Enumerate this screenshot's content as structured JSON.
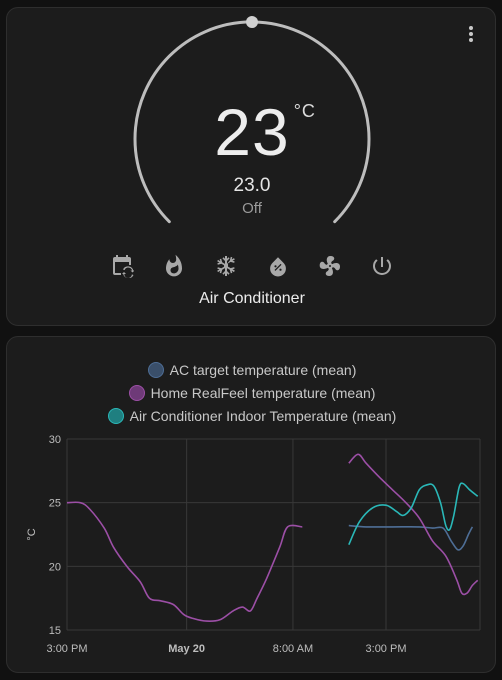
{
  "thermostat": {
    "target_temp": "23",
    "unit": "°C",
    "current_temp": "23.0",
    "hvac_state": "Off",
    "name": "Air Conditioner",
    "setpoint_fraction": 0.5,
    "modes": [
      {
        "icon": "calendar-sync-icon",
        "name": "auto"
      },
      {
        "icon": "fire-icon",
        "name": "heat"
      },
      {
        "icon": "snowflake-icon",
        "name": "cool"
      },
      {
        "icon": "water-percent-icon",
        "name": "dry"
      },
      {
        "icon": "fan-icon",
        "name": "fan_only"
      },
      {
        "icon": "power-icon",
        "name": "off"
      }
    ]
  },
  "history": {
    "legend": [
      {
        "label": "AC target temperature (mean)",
        "color": "#4e6e96"
      },
      {
        "label": "Home RealFeel temperature (mean)",
        "color": "#9c4fa6"
      },
      {
        "label": "Air Conditioner Indoor Temperature (mean)",
        "color": "#2ab8b8"
      }
    ]
  },
  "chart_data": {
    "type": "line",
    "ylabel": "°C",
    "ylim": [
      15,
      30
    ],
    "yticks": [
      15,
      20,
      25,
      30
    ],
    "xticks": [
      {
        "label": "3:00 PM",
        "t": 0,
        "bold": false
      },
      {
        "label": "May 20",
        "t": 9,
        "bold": true
      },
      {
        "label": "8:00 AM",
        "t": 17,
        "bold": false
      },
      {
        "label": "3:00 PM",
        "t": 24,
        "bold": false
      }
    ],
    "xlim": [
      0,
      31
    ],
    "grid": true,
    "series": [
      {
        "name": "AC target temperature (mean)",
        "color": "#4e6e96",
        "points": [
          [
            21.2,
            23.2
          ],
          [
            22.5,
            23.1
          ],
          [
            24.5,
            23.1
          ],
          [
            26.5,
            23.1
          ],
          [
            27.5,
            23.0
          ],
          [
            28.3,
            23.0
          ],
          [
            28.9,
            22.0
          ],
          [
            29.4,
            21.3
          ],
          [
            29.8,
            21.6
          ],
          [
            30.2,
            22.5
          ],
          [
            30.5,
            23.1
          ]
        ]
      },
      {
        "name": "Home RealFeel temperature (mean)",
        "color": "#9c4fa6",
        "points": [
          [
            0,
            25.0
          ],
          [
            1,
            25.0
          ],
          [
            1.7,
            24.5
          ],
          [
            2.8,
            23.0
          ],
          [
            3.5,
            21.5
          ],
          [
            4.5,
            20.0
          ],
          [
            5.5,
            18.8
          ],
          [
            6.2,
            17.5
          ],
          [
            7,
            17.3
          ],
          [
            8,
            17.0
          ],
          [
            8.8,
            16.2
          ],
          [
            9.5,
            15.9
          ],
          [
            10.5,
            15.7
          ],
          [
            11.5,
            15.8
          ],
          [
            12.5,
            16.5
          ],
          [
            13.2,
            16.8
          ],
          [
            13.8,
            16.5
          ],
          [
            14.3,
            17.5
          ],
          [
            15,
            19.0
          ],
          [
            16,
            21.5
          ],
          [
            16.6,
            23.1
          ],
          [
            17.7,
            23.1
          ],
          [
            21.2,
            28.1
          ],
          [
            21.9,
            28.8
          ],
          [
            22.5,
            28.1
          ],
          [
            23.5,
            27.0
          ],
          [
            24.5,
            26.0
          ],
          [
            25.5,
            25.0
          ],
          [
            26.5,
            23.8
          ],
          [
            27.5,
            22.0
          ],
          [
            28.5,
            20.8
          ],
          [
            29.3,
            19.0
          ],
          [
            29.7,
            17.9
          ],
          [
            30.1,
            17.9
          ],
          [
            30.5,
            18.5
          ],
          [
            30.9,
            18.9
          ]
        ]
      },
      {
        "name": "Air Conditioner Indoor Temperature (mean)",
        "color": "#2ab8b8",
        "points": [
          [
            21.2,
            21.7
          ],
          [
            22,
            23.5
          ],
          [
            23,
            24.6
          ],
          [
            24,
            24.8
          ],
          [
            24.8,
            24.3
          ],
          [
            25.3,
            24.0
          ],
          [
            25.9,
            24.6
          ],
          [
            26.5,
            26.0
          ],
          [
            27.1,
            26.4
          ],
          [
            27.6,
            26.3
          ],
          [
            28.1,
            25.0
          ],
          [
            28.5,
            23.2
          ],
          [
            28.8,
            22.9
          ],
          [
            29.1,
            24.0
          ],
          [
            29.5,
            26.2
          ],
          [
            29.8,
            26.5
          ],
          [
            30.3,
            26.0
          ],
          [
            30.9,
            25.5
          ]
        ]
      }
    ]
  }
}
